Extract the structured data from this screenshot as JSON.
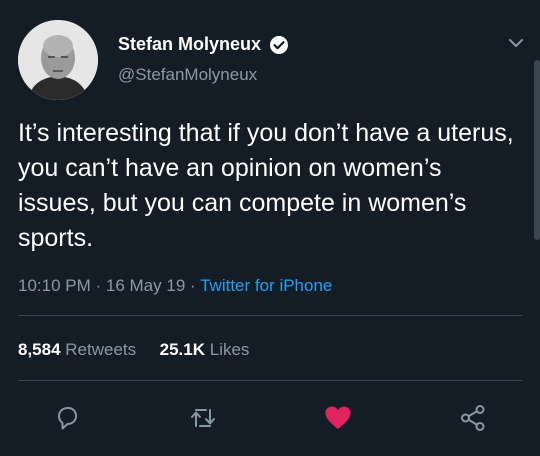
{
  "user": {
    "display_name": "Stefan Molyneux",
    "handle": "@StefanMolyneux"
  },
  "tweet": {
    "text": "It’s interesting that if you don’t have a uterus, you can’t have an opinion on women’s issues, but you can compete in women’s sports.",
    "time": "10:10 PM",
    "date": "16 May 19",
    "source": "Twitter for iPhone"
  },
  "stats": {
    "retweets_count": "8,584",
    "retweets_label": "Retweets",
    "likes_count": "25.1K",
    "likes_label": "Likes"
  },
  "colors": {
    "background": "#141d26",
    "secondary_text": "#8899a6",
    "link": "#1da1f2",
    "like_active": "#e0245e",
    "divider": "#38444d"
  },
  "actions": {
    "liked": true,
    "icons": [
      "reply-icon",
      "retweet-icon",
      "like-icon",
      "share-icon"
    ]
  }
}
